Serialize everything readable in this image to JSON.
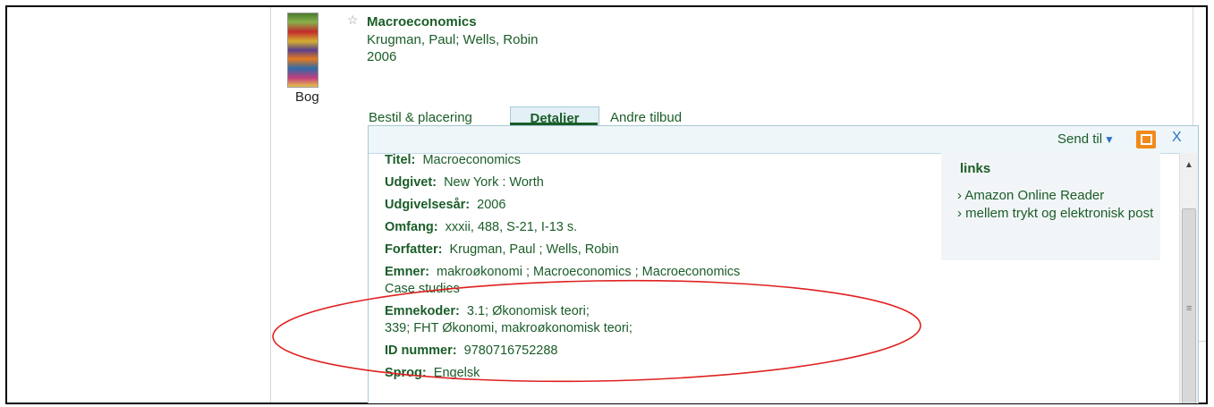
{
  "record": {
    "type_label": "Bog",
    "title": "Macroeconomics",
    "authors": "Krugman, Paul; Wells, Robin",
    "year": "2006"
  },
  "tabs": [
    {
      "label": "Bestil & placering"
    },
    {
      "label": "Detaljer"
    },
    {
      "label": "Andre tilbud"
    }
  ],
  "toolbar": {
    "send_label": "Send til"
  },
  "details": [
    {
      "label": "Titel:",
      "value": "Macroeconomics"
    },
    {
      "label": "Udgivet:",
      "value": "New York : Worth"
    },
    {
      "label": "Udgivelsesår:",
      "value": "2006"
    },
    {
      "label": "Omfang:",
      "value": "xxxii, 488, S-21, I-13 s."
    },
    {
      "label": "Forfatter:",
      "value": "Krugman, Paul ; Wells, Robin"
    },
    {
      "label": "Emner:",
      "value": "makroøkonomi ; Macroeconomics ; Macroeconomics",
      "value2": "Case studies"
    },
    {
      "label": "Emnekoder:",
      "value": "3.1; Økonomisk teori;",
      "value2": "339; FHT Økonomi, makroøkonomisk teori;"
    },
    {
      "label": "ID nummer:",
      "value": "9780716752288"
    },
    {
      "label": "Sprog:",
      "value": "Engelsk"
    }
  ],
  "links": {
    "title": "links",
    "items": [
      "Amazon Online Reader",
      "mellem trykt og elektronisk post"
    ]
  },
  "colors": {
    "text_green": "#1a5d28",
    "accent_orange": "#f08a1c",
    "annotation_red": "#e02020"
  }
}
